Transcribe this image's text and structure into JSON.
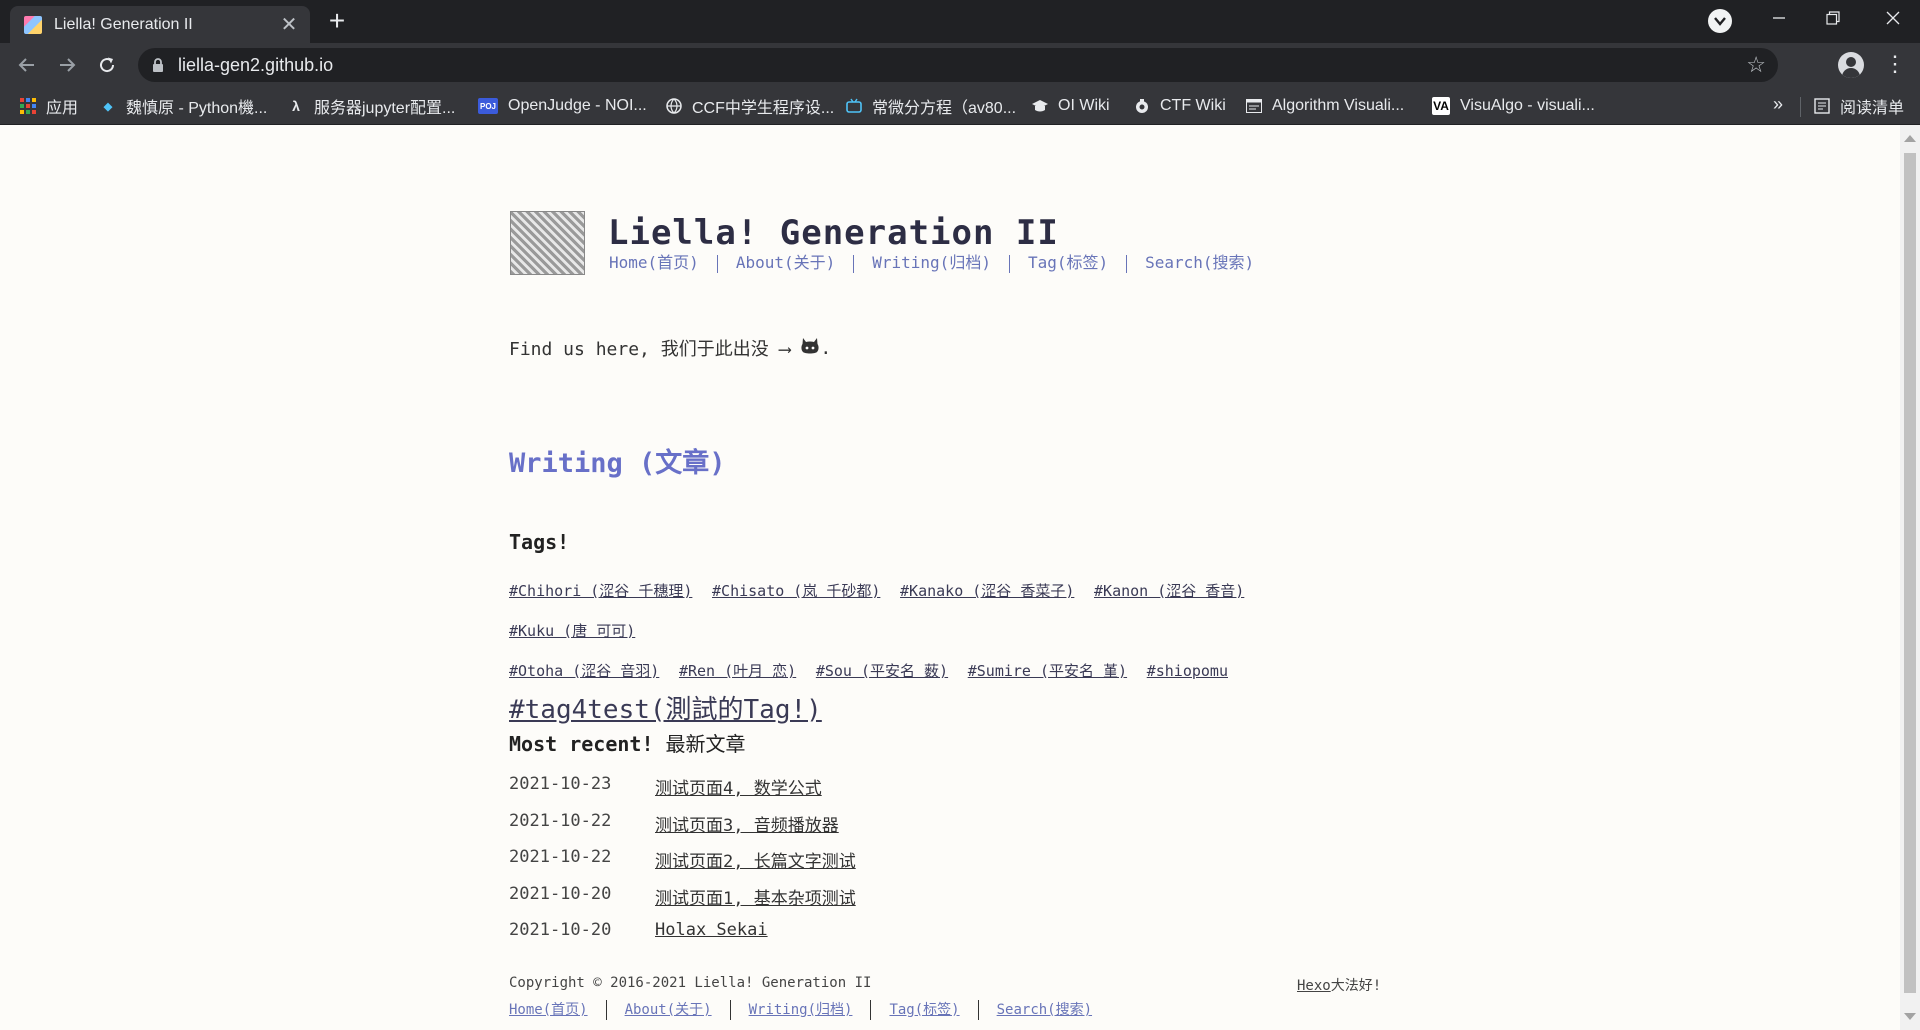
{
  "browser": {
    "tab_title": "Liella! Generation II",
    "tab_close": "✕",
    "new_tab": "+",
    "url": "liella-gen2.github.io",
    "bookmarks": [
      {
        "label": "应用",
        "icon": "apps-grid-icon"
      },
      {
        "label": "魏慎原 - Python機...",
        "icon": "bird-icon"
      },
      {
        "label": "服务器jupyter配置...",
        "icon": "lambda-icon"
      },
      {
        "label": "OpenJudge - NOI...",
        "icon": "poj-icon"
      },
      {
        "label": "CCF中学生程序设...",
        "icon": "globe-icon"
      },
      {
        "label": "常微分方程（av80...",
        "icon": "bilibili-icon"
      },
      {
        "label": "OI Wiki",
        "icon": "graduation-cap-icon"
      },
      {
        "label": "CTF Wiki",
        "icon": "ctf-icon"
      },
      {
        "label": "Algorithm Visuali...",
        "icon": "window-icon"
      },
      {
        "label": "VisuAlgo - visuali...",
        "icon": "visualgo-icon"
      }
    ],
    "bookmarks_more": "»",
    "reading_list": "阅读清单"
  },
  "site": {
    "title": "Liella! Generation II",
    "nav": [
      "Home(首页)",
      "About(关于)",
      "Writing(归档)",
      "Tag(标签)",
      "Search(搜索)"
    ],
    "find_text": "Find us here, 我们于此出没 ⟶",
    "find_end": ".",
    "writing_title": "Writing (文章)",
    "tags_heading": "Tags!",
    "tags": [
      "#Chihori (涩谷 千穗理)",
      "#Chisato (岚 千砂都)",
      "#Kanako (涩谷 香菜子)",
      "#Kanon (涩谷 香音)",
      "#Kuku (唐 可可)",
      "#Otoha (涩谷 音羽)",
      "#Ren (叶月 恋)",
      "#Sou (平安名 薮)",
      "#Sumire (平安名 堇)",
      "#shiopomu",
      "#tag4test(測試的Tag!)"
    ],
    "recent_heading": "Most recent!",
    "recent_heading_cn": "最新文章",
    "posts": [
      {
        "date": "2021-10-23",
        "title": "测试页面4, 数学公式"
      },
      {
        "date": "2021-10-22",
        "title": "测试页面3, 音频播放器"
      },
      {
        "date": "2021-10-22",
        "title": "测试页面2, 长篇文字测试"
      },
      {
        "date": "2021-10-20",
        "title": "测试页面1, 基本杂项测试"
      },
      {
        "date": "2021-10-20",
        "title": "Holax Sekai"
      }
    ],
    "copyright": "Copyright © 2016-2021 Liella! Generation II",
    "hexo_link": "Hexo",
    "hexo_suffix": "大法好!",
    "footer_nav": [
      "Home(首页)",
      "About(关于)",
      "Writing(归档)",
      "Tag(标签)",
      "Search(搜索)"
    ]
  },
  "colors": {
    "chrome_dark": "#202124",
    "chrome_toolbar": "#35363a",
    "page_bg": "#fdfcf9",
    "link_accent": "#6874b8",
    "writing_accent": "#6870c8"
  }
}
